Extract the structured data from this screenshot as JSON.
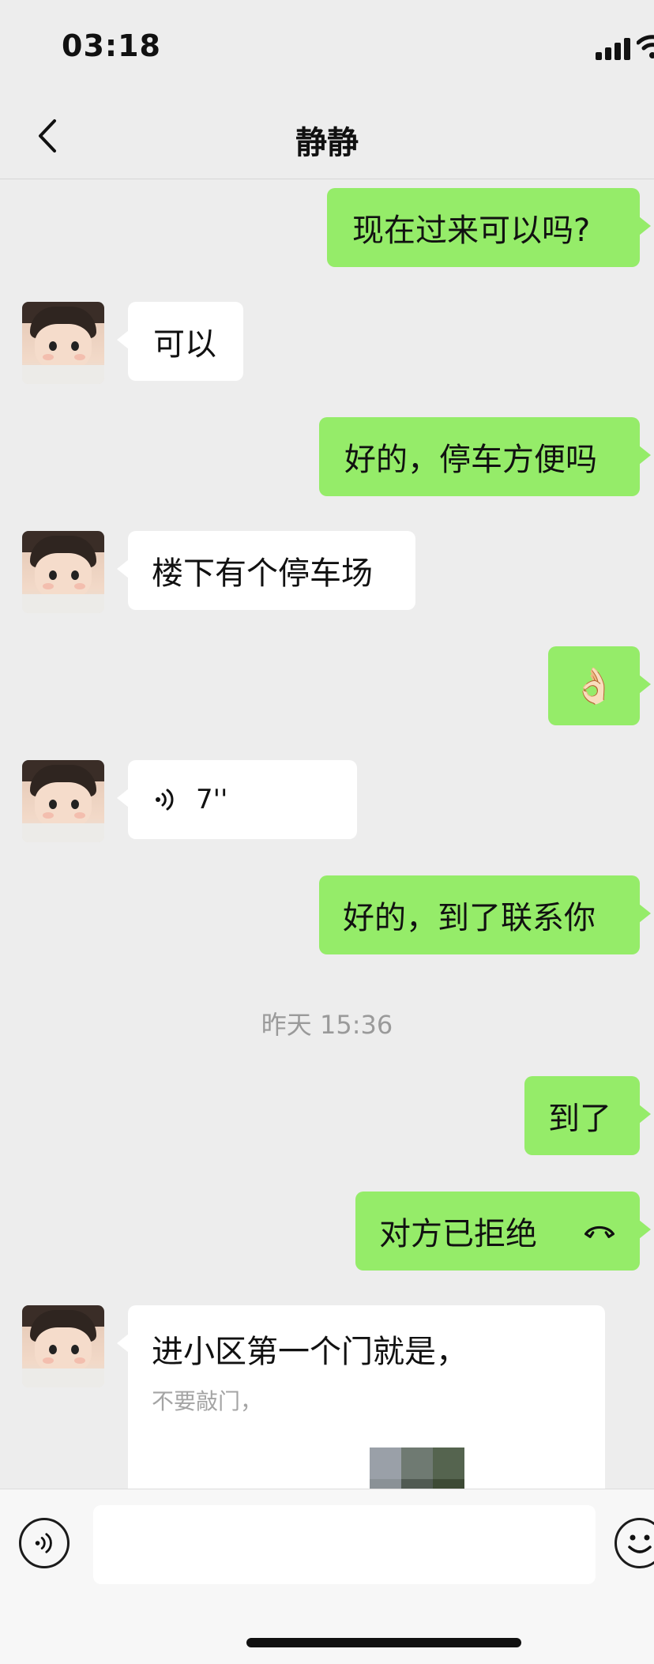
{
  "status_bar": {
    "time": "03:18"
  },
  "nav": {
    "title": "静静"
  },
  "messages": {
    "m1": "现在过来可以吗?",
    "m2": "可以",
    "m3": "好的，停车方便吗",
    "m4": "楼下有个停车场",
    "m5_emoji": "👌🏻",
    "m6_voice_duration": "7''",
    "m7": "好的，到了联系你",
    "timestamp": "昨天 15:36",
    "m8": "到了",
    "m9_call": "对方已拒绝",
    "m10_main": "进小区第一个门就是，",
    "m10_sub": "不要敲门，"
  },
  "input": {
    "placeholder": ""
  },
  "colors": {
    "outgoing_bubble": "#95ec69",
    "incoming_bubble": "#ffffff",
    "background": "#ededed"
  },
  "icons": [
    "back-chevron-icon",
    "signal-icon",
    "wifi-icon",
    "voice-wave-icon",
    "phone-hangup-icon",
    "voice-toggle-icon",
    "emoji-icon"
  ]
}
